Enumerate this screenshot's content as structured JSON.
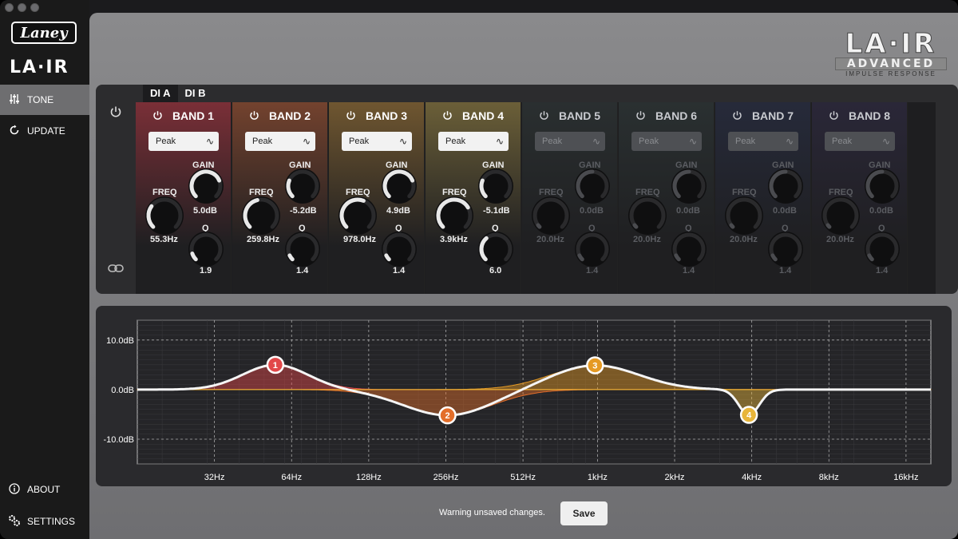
{
  "sidebar": {
    "brand_logo_text": "Laney",
    "product_logo_text": "LA·IR",
    "nav": [
      {
        "label": "TONE",
        "icon": "sliders-icon",
        "active": true
      },
      {
        "label": "UPDATE",
        "icon": "refresh-icon",
        "active": false
      }
    ],
    "footer_nav": [
      {
        "label": "ABOUT",
        "icon": "info-icon"
      },
      {
        "label": "SETTINGS",
        "icon": "gear-icon"
      }
    ]
  },
  "brand": {
    "title": "LA·IR",
    "line1": "ADVANCED",
    "line2": "IMPULSE RESPONSE"
  },
  "tabs": [
    {
      "label": "DI A",
      "active": true
    },
    {
      "label": "DI B",
      "active": false
    }
  ],
  "colors": {
    "band1": "#e2484a",
    "band2": "#e36e2a",
    "band3": "#e59a24",
    "band4": "#e8b53a",
    "accent_knob": "#e6e6e6"
  },
  "bands": [
    {
      "name": "BAND 1",
      "type": "Peak",
      "freq_label": "FREQ",
      "freq": "55.3Hz",
      "gain_label": "GAIN",
      "gain": "5.0dB",
      "q_label": "Q",
      "q": "1.9",
      "enabled": true,
      "freq_level": 0.3,
      "gain_level": 0.75,
      "q_level": 0.1
    },
    {
      "name": "BAND 2",
      "type": "Peak",
      "freq_label": "FREQ",
      "freq": "259.8Hz",
      "gain_label": "GAIN",
      "gain": "-5.2dB",
      "q_label": "Q",
      "q": "1.4",
      "enabled": true,
      "freq_level": 0.45,
      "gain_level": 0.25,
      "q_level": 0.07
    },
    {
      "name": "BAND 3",
      "type": "Peak",
      "freq_label": "FREQ",
      "freq": "978.0Hz",
      "gain_label": "GAIN",
      "gain": "4.9dB",
      "q_label": "Q",
      "q": "1.4",
      "enabled": true,
      "freq_level": 0.58,
      "gain_level": 0.75,
      "q_level": 0.07
    },
    {
      "name": "BAND 4",
      "type": "Peak",
      "freq_label": "FREQ",
      "freq": "3.9kHz",
      "gain_label": "GAIN",
      "gain": "-5.1dB",
      "q_label": "Q",
      "q": "6.0",
      "enabled": true,
      "freq_level": 0.72,
      "gain_level": 0.25,
      "q_level": 0.35
    },
    {
      "name": "BAND 5",
      "type": "Peak",
      "freq_label": "FREQ",
      "freq": "20.0Hz",
      "gain_label": "GAIN",
      "gain": "0.0dB",
      "q_label": "Q",
      "q": "1.4",
      "enabled": false,
      "freq_level": 0.0,
      "gain_level": 0.5,
      "q_level": 0.07
    },
    {
      "name": "BAND 6",
      "type": "Peak",
      "freq_label": "FREQ",
      "freq": "20.0Hz",
      "gain_label": "GAIN",
      "gain": "0.0dB",
      "q_label": "Q",
      "q": "1.4",
      "enabled": false,
      "freq_level": 0.0,
      "gain_level": 0.5,
      "q_level": 0.07
    },
    {
      "name": "BAND 7",
      "type": "Peak",
      "freq_label": "FREQ",
      "freq": "20.0Hz",
      "gain_label": "GAIN",
      "gain": "0.0dB",
      "q_label": "Q",
      "q": "1.4",
      "enabled": false,
      "freq_level": 0.0,
      "gain_level": 0.5,
      "q_level": 0.07
    },
    {
      "name": "BAND 8",
      "type": "Peak",
      "freq_label": "FREQ",
      "freq": "20.0Hz",
      "gain_label": "GAIN",
      "gain": "0.0dB",
      "q_label": "Q",
      "q": "1.4",
      "enabled": false,
      "freq_level": 0.0,
      "gain_level": 0.5,
      "q_level": 0.07
    }
  ],
  "band_palette": [
    "#7a2f37",
    "#73422e",
    "#6f5630",
    "#6b5f38",
    "#2a2f30",
    "#2a3031",
    "#262a3a",
    "#2a2738"
  ],
  "chart_data": {
    "type": "line",
    "y_tick_labels": [
      "10.0dB",
      "0.0dB",
      "-10.0dB"
    ],
    "x_tick_labels": [
      "32Hz",
      "64Hz",
      "128Hz",
      "256Hz",
      "512Hz",
      "1kHz",
      "2kHz",
      "4kHz",
      "8kHz",
      "16kHz"
    ],
    "x_ticks_hz": [
      32,
      64,
      128,
      256,
      512,
      1000,
      2000,
      4000,
      8000,
      16000
    ],
    "y_ticks_db": [
      10,
      0,
      -10
    ],
    "xlim_hz": [
      16,
      20000
    ],
    "ylim_db": [
      -15,
      14
    ],
    "log_x": true,
    "grid": true,
    "nodes": [
      {
        "label": "1",
        "freq_hz": 55.3,
        "gain_db": 5.0,
        "q": 1.9
      },
      {
        "label": "2",
        "freq_hz": 259.8,
        "gain_db": -5.2,
        "q": 1.4
      },
      {
        "label": "3",
        "freq_hz": 978.0,
        "gain_db": 4.9,
        "q": 1.4
      },
      {
        "label": "4",
        "freq_hz": 3900,
        "gain_db": -5.1,
        "q": 6.0
      }
    ]
  },
  "footer": {
    "status": "Warning unsaved changes.",
    "save_label": "Save"
  }
}
